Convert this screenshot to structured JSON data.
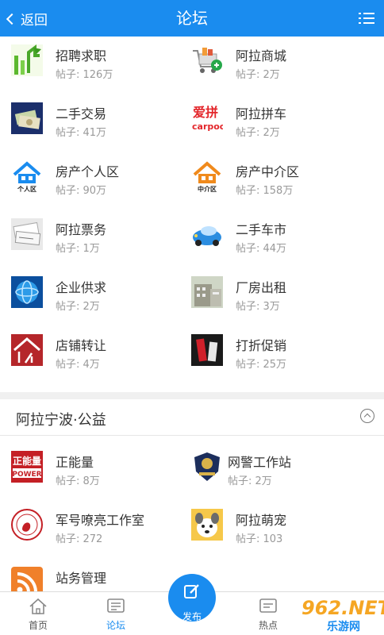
{
  "header": {
    "back_label": "返回",
    "title": "论坛",
    "menu_icon": "list-icon"
  },
  "forums": [
    {
      "name": "招聘求职",
      "count": "帖子: 126万",
      "icon": "recruit-icon"
    },
    {
      "name": "阿拉商城",
      "count": "帖子: 2万",
      "icon": "shopping-cart-icon"
    },
    {
      "name": "二手交易",
      "count": "帖子: 41万",
      "icon": "money-icon"
    },
    {
      "name": "阿拉拼车",
      "count": "帖子: 2万",
      "icon": "carpool-icon"
    },
    {
      "name": "房产个人区",
      "count": "帖子: 90万",
      "icon": "house-personal-icon",
      "tag": "个人区"
    },
    {
      "name": "房产中介区",
      "count": "帖子: 158万",
      "icon": "house-agent-icon",
      "tag": "中介区"
    },
    {
      "name": "阿拉票务",
      "count": "帖子: 1万",
      "icon": "ticket-icon"
    },
    {
      "name": "二手车市",
      "count": "帖子: 44万",
      "icon": "car-icon"
    },
    {
      "name": "企业供求",
      "count": "帖子: 2万",
      "icon": "globe-icon"
    },
    {
      "name": "厂房出租",
      "count": "帖子: 3万",
      "icon": "building-icon"
    },
    {
      "name": "店铺转让",
      "count": "帖子: 4万",
      "icon": "shop-transfer-icon"
    },
    {
      "name": "打折促销",
      "count": "帖子: 25万",
      "icon": "discount-icon"
    }
  ],
  "section": {
    "title": "阿拉宁波·公益",
    "items": [
      {
        "name": "正能量",
        "count": "帖子: 8万",
        "icon": "positive-energy-icon"
      },
      {
        "name": "网警工作站",
        "count": "帖子: 2万",
        "icon": "police-badge-icon"
      },
      {
        "name": "军号嘹亮工作室",
        "count": "帖子: 272",
        "icon": "bugle-icon"
      },
      {
        "name": "阿拉萌宠",
        "count": "帖子: 103",
        "icon": "pet-icon"
      },
      {
        "name": "站务管理",
        "count": "",
        "icon": "rss-icon"
      }
    ]
  },
  "tabs": [
    {
      "label": "首页",
      "icon": "home-icon"
    },
    {
      "label": "论坛",
      "icon": "forum-icon"
    },
    {
      "label": "发布",
      "icon": "edit-icon"
    },
    {
      "label": "热点",
      "icon": "hot-icon"
    }
  ],
  "watermark": {
    "text": "962.NET",
    "sub": "乐游网"
  },
  "colors": {
    "primary": "#1a8cef",
    "text": "#333333",
    "subtext": "#999999"
  }
}
